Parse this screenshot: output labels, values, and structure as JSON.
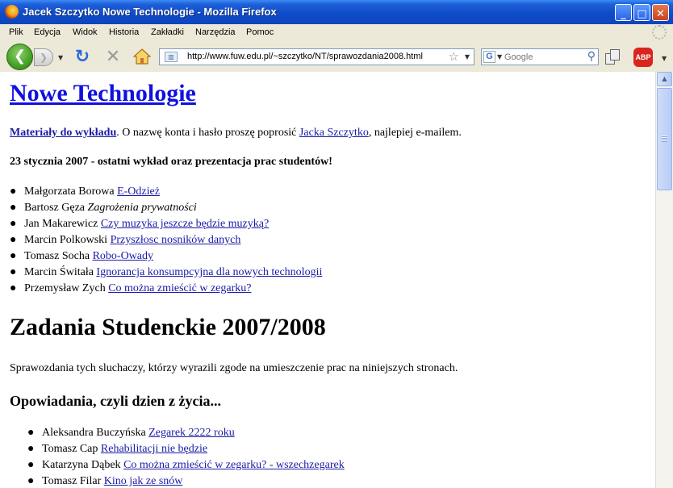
{
  "window": {
    "title": "Jacek Szczytko Nowe Technologie - Mozilla Firefox",
    "icon": "firefox-icon"
  },
  "menubar": {
    "items": [
      {
        "label": "Plik"
      },
      {
        "label": "Edycja"
      },
      {
        "label": "Widok"
      },
      {
        "label": "Historia"
      },
      {
        "label": "Zakładki"
      },
      {
        "label": "Narzędzia"
      },
      {
        "label": "Pomoc"
      }
    ]
  },
  "navbar": {
    "url": "http://www.fuw.edu.pl/~szczytko/NT/sprawozdania2008.html",
    "search_placeholder": "Google",
    "adblock_label": "ABP"
  },
  "page": {
    "title": "Nowe Technologie",
    "intro": {
      "materials_link": "Materiały do wykładu",
      "text1": ". O nazwę konta i hasło proszę poprosić ",
      "person_link": "Jacka Szczytko",
      "text2": ", najlepiej e-mailem."
    },
    "announcement": "23 stycznia 2007 - ostatni wykład oraz prezentacja prac studentów!",
    "presentations": [
      {
        "name": "Małgorzata Borowa",
        "topic": "E-Odzież",
        "link": true
      },
      {
        "name": "Bartosz Gęza",
        "topic": "Zagrożenia prywatności",
        "link": false
      },
      {
        "name": "Jan Makarewicz",
        "topic": "Czy muzyka jeszcze będzie muzyką?",
        "link": true
      },
      {
        "name": "Marcin Polkowski",
        "topic": "Przyszłosc nosników danych",
        "link": true
      },
      {
        "name": "Tomasz Socha",
        "topic": "Robo-Owady",
        "link": true
      },
      {
        "name": "Marcin Świtała",
        "topic": "Ignorancja konsumpcyjna dla nowych technologii",
        "link": true
      },
      {
        "name": "Przemysław Zych",
        "topic": "Co można zmieścić w zegarku?",
        "link": true
      }
    ],
    "section_heading": "Zadania Studenckie 2007/2008",
    "section_desc": "Sprawozdania tych sluchaczy, którzy wyrazili zgode na umieszczenie prac na niniejszych stronach.",
    "subsection_heading": "Opowiadania, czyli dzien z życia...",
    "stories": [
      {
        "name": "Aleksandra Buczyńska",
        "topic": "Zegarek 2222 roku"
      },
      {
        "name": "Tomasz Cap",
        "topic": "Rehabilitacji nie będzie"
      },
      {
        "name": "Katarzyna Dąbek",
        "topic": "Co można zmieścić w zegarku? - wszechzegarek"
      },
      {
        "name": "Tomasz Filar",
        "topic": "Kino jak ze snów"
      }
    ]
  }
}
